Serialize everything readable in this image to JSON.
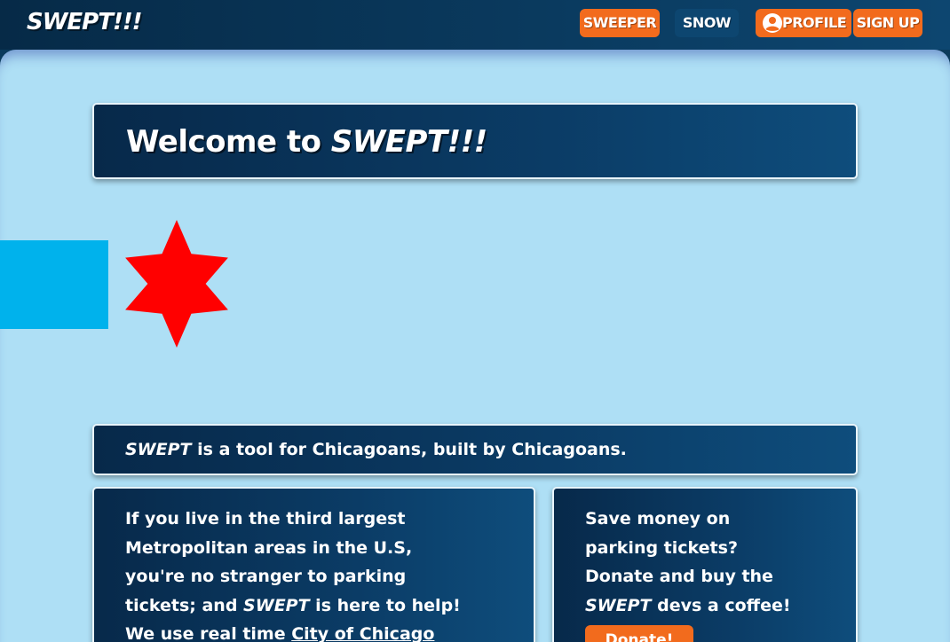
{
  "navbar": {
    "brand": "SWEPT!!!",
    "sweeper_label": "SWEEPER",
    "snow_label": "SNOW",
    "profile_label": "PROFILE",
    "signup_label": "SIGN UP",
    "profile_icon": "user-circle-icon"
  },
  "welcome": {
    "prefix": "Welcome to ",
    "brand": "SWEPT!!!"
  },
  "flag": {
    "stripe_color": "#00b2ec",
    "star_color": "#ff0000"
  },
  "tagline": {
    "brand": "SWEPT",
    "text": " is a tool for Chicagoans, built by Chicagoans."
  },
  "info_left": {
    "line1": "If you live in the third largest",
    "line2": "Metropolitan areas in the U.S,",
    "line3": "you're no stranger to parking",
    "line4_prefix": "tickets; and ",
    "line4_brand": "SWEPT",
    "line4_suffix": " is here to help!",
    "line5_prefix": "We use real time ",
    "line5_link": "City of Chicago"
  },
  "info_right": {
    "line1": "Save money on",
    "line2": "parking tickets?",
    "line3": "Donate and buy the",
    "line4_brand": "SWEPT",
    "line4_suffix": " devs a coffee!",
    "donate_label": "Donate!"
  },
  "colors": {
    "accent": "#f26b1d",
    "nav_bg": "#062a47",
    "page_bg": "#aedff5",
    "card_bg": "#0b3c66"
  }
}
